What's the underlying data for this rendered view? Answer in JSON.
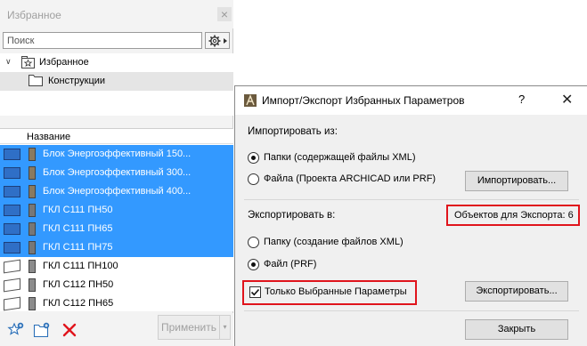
{
  "favorites_panel": {
    "title": "Избранное",
    "close_glyph": "×",
    "search": {
      "placeholder": "Поиск",
      "value": ""
    },
    "tree": {
      "root": {
        "label": "Избранное",
        "expanded": true
      },
      "child": {
        "label": "Конструкции"
      }
    },
    "list": {
      "header": "Название",
      "items": [
        {
          "label": "Блок Энергоэффективный 150...",
          "selected": true
        },
        {
          "label": "Блок Энергоэффективный 300...",
          "selected": true
        },
        {
          "label": "Блок Энергоэффективный 400...",
          "selected": true
        },
        {
          "label": "ГКЛ С111 ПН50",
          "selected": true
        },
        {
          "label": "ГКЛ С111 ПН65",
          "selected": true
        },
        {
          "label": "ГКЛ С111 ПН75",
          "selected": true
        },
        {
          "label": "ГКЛ С111 ПН100",
          "selected": false
        },
        {
          "label": "ГКЛ С112 ПН50",
          "selected": false
        },
        {
          "label": "ГКЛ С112 ПН65",
          "selected": false
        }
      ]
    },
    "toolbar": {
      "add_favorite_icon": "add-favorite-icon",
      "add_folder_icon": "add-folder-icon",
      "delete_icon": "delete-icon",
      "apply_label": "Применить",
      "apply_arrow": "▾"
    }
  },
  "dialog": {
    "title": "Импорт/Экспорт Избранных Параметров",
    "help_glyph": "?",
    "close_glyph": "✕",
    "import": {
      "label": "Импортировать из:",
      "options": [
        {
          "label": "Папки (содержащей файлы XML)",
          "checked": true
        },
        {
          "label": "Файла (Проекта ARCHICAD или PRF)",
          "checked": false
        }
      ],
      "button": "Импортировать..."
    },
    "export": {
      "label": "Экспортировать в:",
      "count_text": "Объектов для Экспорта: 6",
      "options": [
        {
          "label": "Папку (создание файлов XML)",
          "checked": false
        },
        {
          "label": "Файл (PRF)",
          "checked": true
        }
      ],
      "only_selected_label": "Только Выбранные Параметры",
      "only_selected_checked": true,
      "button": "Экспортировать..."
    },
    "close_button": "Закрыть"
  },
  "colors": {
    "selection": "#3399ff",
    "highlight_box": "#e0141c",
    "delete_icon": "#e0141c"
  }
}
